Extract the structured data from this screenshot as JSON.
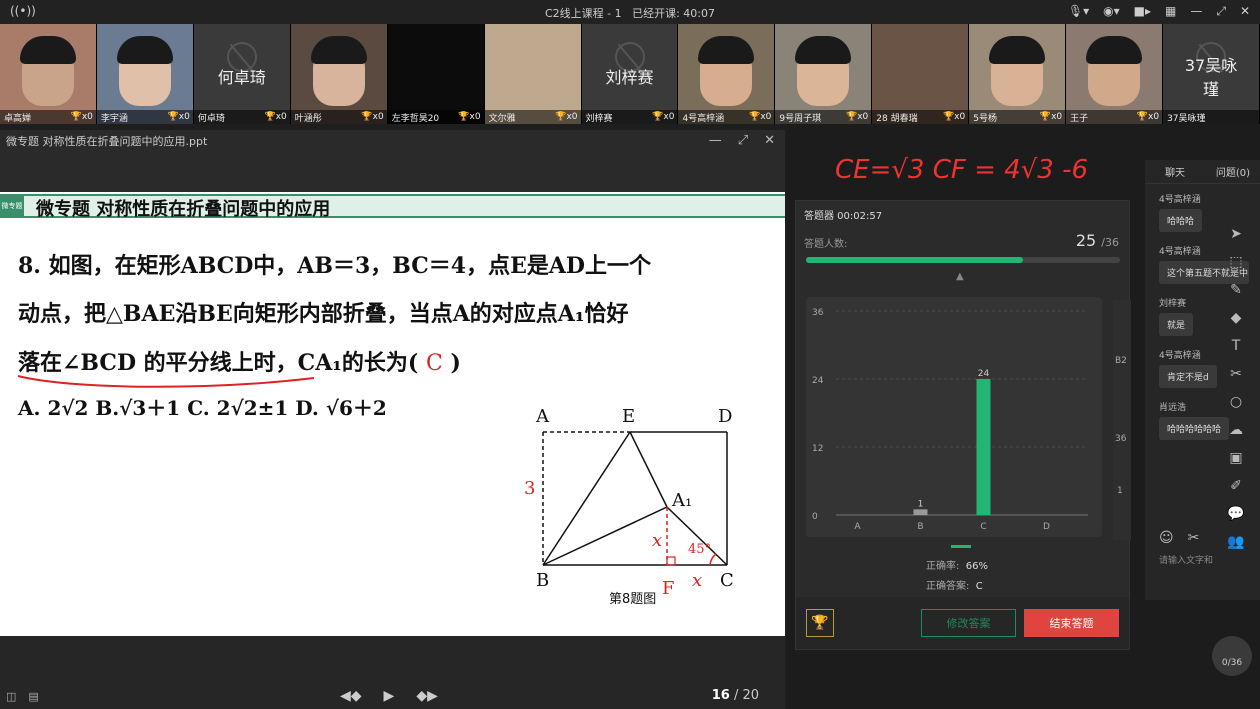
{
  "titlebar": {
    "title": "C2线上课程 - 1",
    "elapsed": "已经开课: 40:07"
  },
  "videos": [
    {
      "name": "卓高婵",
      "big": "",
      "trophy": "x0",
      "face": "#c9a38a",
      "bg": "#a97c6a"
    },
    {
      "name": "李宇涵",
      "big": "",
      "trophy": "x0",
      "face": "#e0c0a8",
      "bg": "#6b7b92"
    },
    {
      "name": "何卓琦",
      "big": "何卓琦",
      "trophy": "x0",
      "face": "",
      "bg": "#3a3a3a"
    },
    {
      "name": "叶涵彤",
      "big": "",
      "trophy": "x0",
      "face": "#d7b49b",
      "bg": "#5a4a40"
    },
    {
      "name": "左李哲昊20",
      "big": "",
      "trophy": "x0",
      "face": "",
      "bg": "#0c0c0c"
    },
    {
      "name": "文尔雅",
      "big": "",
      "trophy": "x0",
      "face": "",
      "bg": "#bfa98e"
    },
    {
      "name": "刘梓赛",
      "big": "刘梓赛",
      "trophy": "x0",
      "face": "",
      "bg": "#3a3a3a"
    },
    {
      "name": "4号高梓涵",
      "big": "",
      "trophy": "x0",
      "face": "#d6ad8e",
      "bg": "#7a6d5a"
    },
    {
      "name": "9号周子琪",
      "big": "",
      "trophy": "x0",
      "face": "#dbb598",
      "bg": "#8a8378"
    },
    {
      "name": "28 胡春瑞",
      "big": "",
      "trophy": "x0",
      "face": "",
      "bg": "#6a5446"
    },
    {
      "name": "5号杨",
      "big": "",
      "trophy": "x0",
      "face": "#d9b296",
      "bg": "#9a8a78"
    },
    {
      "name": "王子",
      "big": "",
      "trophy": "x0",
      "face": "#cfa98a",
      "bg": "#8a7a70"
    },
    {
      "name": "37吴咏瑾",
      "big": "37吴咏\n瑾",
      "trophy": "",
      "face": "",
      "bg": "#3a3a3a"
    }
  ],
  "ppt": {
    "filename": "微专题  对称性质在折叠问题中的应用.ppt",
    "page_current": "16",
    "page_total": "/ 20"
  },
  "slide": {
    "badge": "微专题",
    "header": "微专题   对称性质在折叠问题中的应用",
    "line1": "8. 如图，在矩形ABCD中，AB＝3，BC＝4，点E是AD上一个",
    "line2": "动点，把△BAE沿BE向矩形内部折叠，当点A的对应点A₁恰好",
    "line3a": "落在∠BCD 的平分线上时，CA₁的长为(",
    "line3ans": "C",
    "line3b": ")",
    "choices": "A. 2√2     B.√3＋1     C. 2√2±1     D.  √6＋2",
    "fig_labels": {
      "A": "A",
      "E": "E",
      "D": "D",
      "B": "B",
      "C": "C",
      "A1": "A₁"
    },
    "fig_caption": "第8题图",
    "hand_3": "3",
    "hand_x": "x",
    "hand_x2": "x",
    "hand_F": "F",
    "hand_45": "45°"
  },
  "handwriting": {
    "formula": "CE=√3 CF = 4√3 -6"
  },
  "quiz": {
    "title": "答题器  00:02:57",
    "count_label": "答题人数:",
    "count": "25",
    "total": "/36",
    "progress": 0.69,
    "accuracy_label": "正确率:",
    "accuracy": "66%",
    "answer_label": "正确答案:",
    "answer": "C",
    "edit_label": "修改答案",
    "end_label": "结束答题",
    "peek_labels": [
      "B2",
      "36",
      "1"
    ]
  },
  "chart_data": {
    "type": "bar",
    "categories": [
      "A",
      "B",
      "C",
      "D"
    ],
    "values": [
      0,
      1,
      24,
      0
    ],
    "ylim": [
      0,
      36
    ],
    "yticks": [
      0,
      12,
      24,
      36
    ],
    "grid": true,
    "colors": {
      "bar": "#22b573",
      "bar_minor": "#9a9a9a"
    }
  },
  "chat": {
    "tab_chat": "聊天",
    "tab_q": "问题(0)",
    "messages": [
      {
        "who": "4号高梓涵",
        "text": "哈哈哈"
      },
      {
        "who": "4号高梓涵",
        "text": "这个第五题不就是中"
      },
      {
        "who": "刘梓赛",
        "text": "就是"
      },
      {
        "who": "4号高梓涵",
        "text": "肯定不是d"
      },
      {
        "who": "肖远浩",
        "text": "哈哈哈哈哈哈"
      }
    ],
    "input_placeholder": "请输入文字和",
    "counter": "0/36"
  }
}
